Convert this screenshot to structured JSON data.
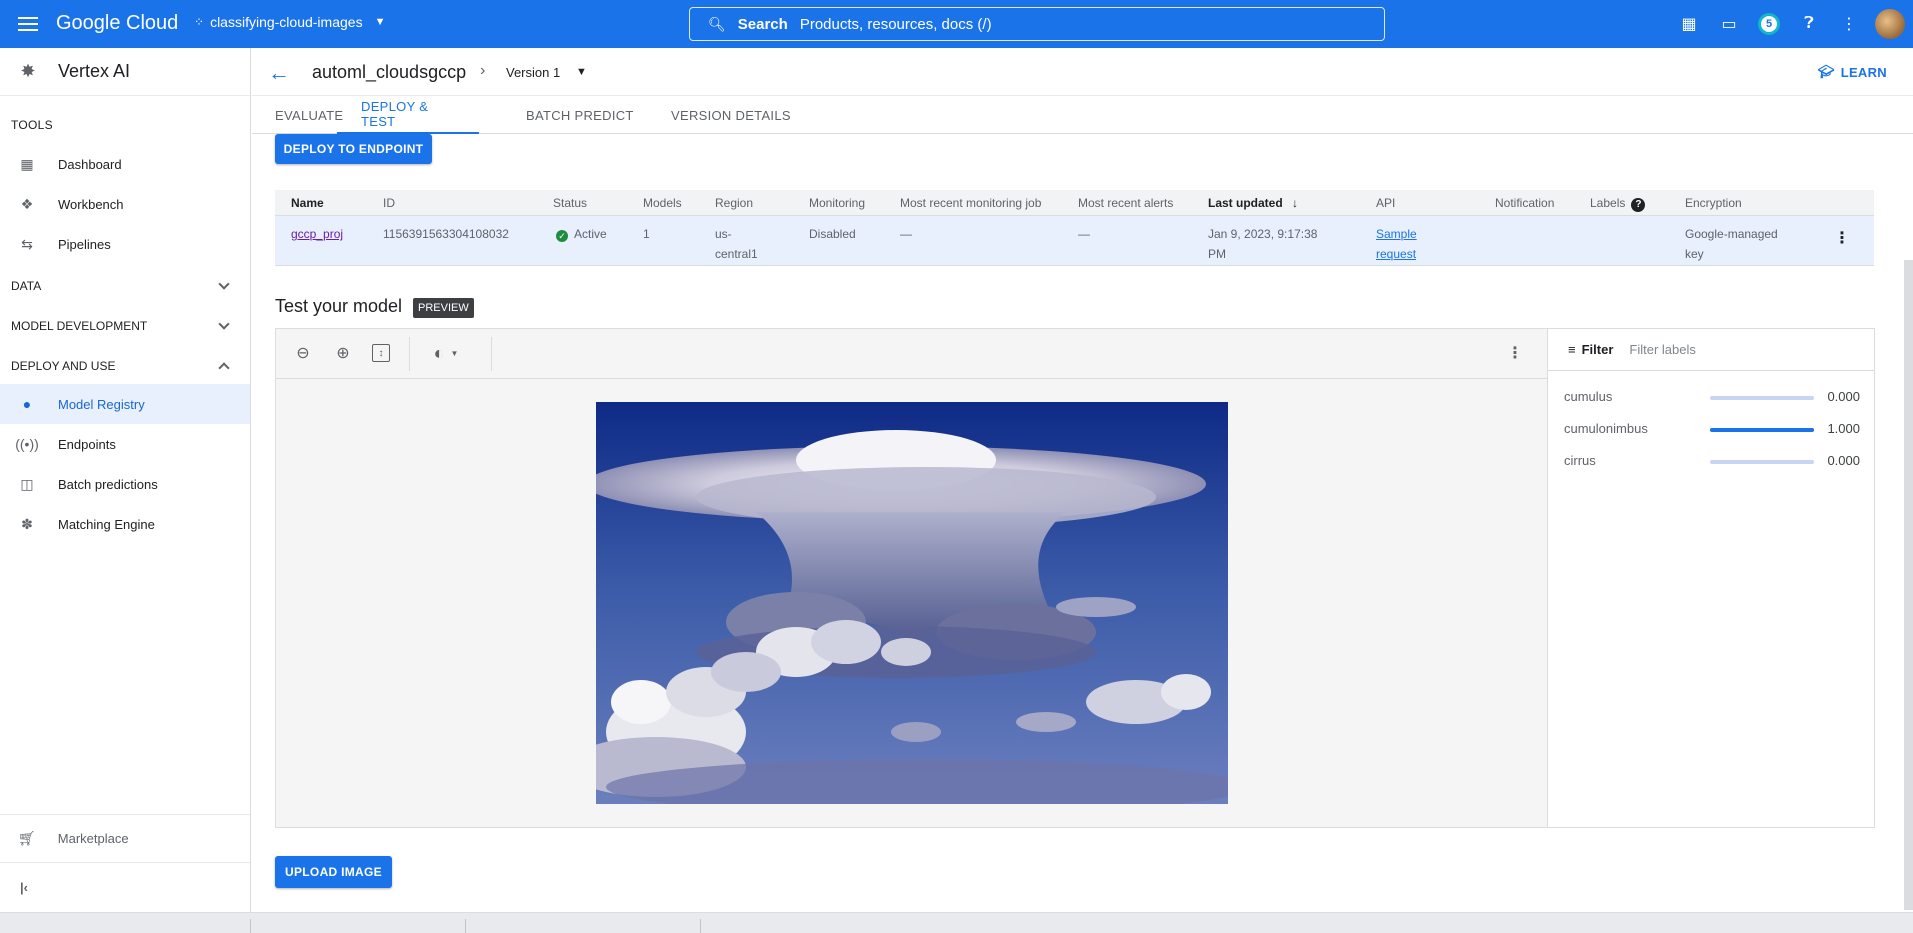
{
  "topbar": {
    "brand": "Google Cloud",
    "project": "classifying-cloud-images",
    "search_label": "Search",
    "search_placeholder": "Products, resources, docs (/)",
    "notification_count": "5"
  },
  "sidebar": {
    "product": "Vertex AI",
    "tools_heading": "TOOLS",
    "tools": [
      {
        "label": "Dashboard",
        "icon": "dashboard-icon"
      },
      {
        "label": "Workbench",
        "icon": "workbench-icon"
      },
      {
        "label": "Pipelines",
        "icon": "pipelines-icon"
      }
    ],
    "groups": [
      {
        "label": "DATA",
        "expanded": false
      },
      {
        "label": "MODEL DEVELOPMENT",
        "expanded": false
      },
      {
        "label": "DEPLOY AND USE",
        "expanded": true
      }
    ],
    "deploy_items": [
      {
        "label": "Model Registry",
        "icon": "lightbulb-icon",
        "active": true
      },
      {
        "label": "Endpoints",
        "icon": "endpoints-icon",
        "active": false
      },
      {
        "label": "Batch predictions",
        "icon": "batch-icon",
        "active": false
      },
      {
        "label": "Matching Engine",
        "icon": "matching-icon",
        "active": false
      }
    ],
    "marketplace": "Marketplace"
  },
  "header": {
    "model_name": "automl_cloudsgccp",
    "version": "Version 1",
    "learn": "LEARN"
  },
  "tabs": [
    {
      "label": "EVALUATE",
      "active": false
    },
    {
      "label": "DEPLOY & TEST",
      "active": true
    },
    {
      "label": "BATCH PREDICT",
      "active": false
    },
    {
      "label": "VERSION DETAILS",
      "active": false
    }
  ],
  "deploy_button": "DEPLOY TO ENDPOINT",
  "endpoints_table": {
    "columns": [
      "Name",
      "ID",
      "Status",
      "Models",
      "Region",
      "Monitoring",
      "Most recent monitoring job",
      "Most recent alerts",
      "Last updated",
      "API",
      "Notification",
      "Labels",
      "Encryption"
    ],
    "row": {
      "name": "gccp_proj",
      "id": "1156391563304108032",
      "status": "Active",
      "models": "1",
      "region_line1": "us-",
      "region_line2": "central1",
      "monitoring": "Disabled",
      "recent_job": "—",
      "recent_alerts": "—",
      "updated_line1": "Jan 9, 2023, 9:17:38",
      "updated_line2": "PM",
      "api_line1": "Sample",
      "api_line2": "request",
      "encryption_line1": "Google-managed",
      "encryption_line2": "key"
    }
  },
  "test": {
    "title": "Test your model",
    "preview_tag": "PREVIEW",
    "filter_label": "Filter",
    "filter_placeholder": "Filter labels",
    "predictions": [
      {
        "label": "cumulus",
        "score": 0.0,
        "score_text": "0.000"
      },
      {
        "label": "cumulonimbus",
        "score": 1.0,
        "score_text": "1.000"
      },
      {
        "label": "cirrus",
        "score": 0.0,
        "score_text": "0.000"
      }
    ]
  },
  "upload_button": "UPLOAD IMAGE",
  "colors": {
    "accent": "#1a73e8",
    "active_bg": "#e8f0fe",
    "status_green": "#1e8e3e"
  }
}
